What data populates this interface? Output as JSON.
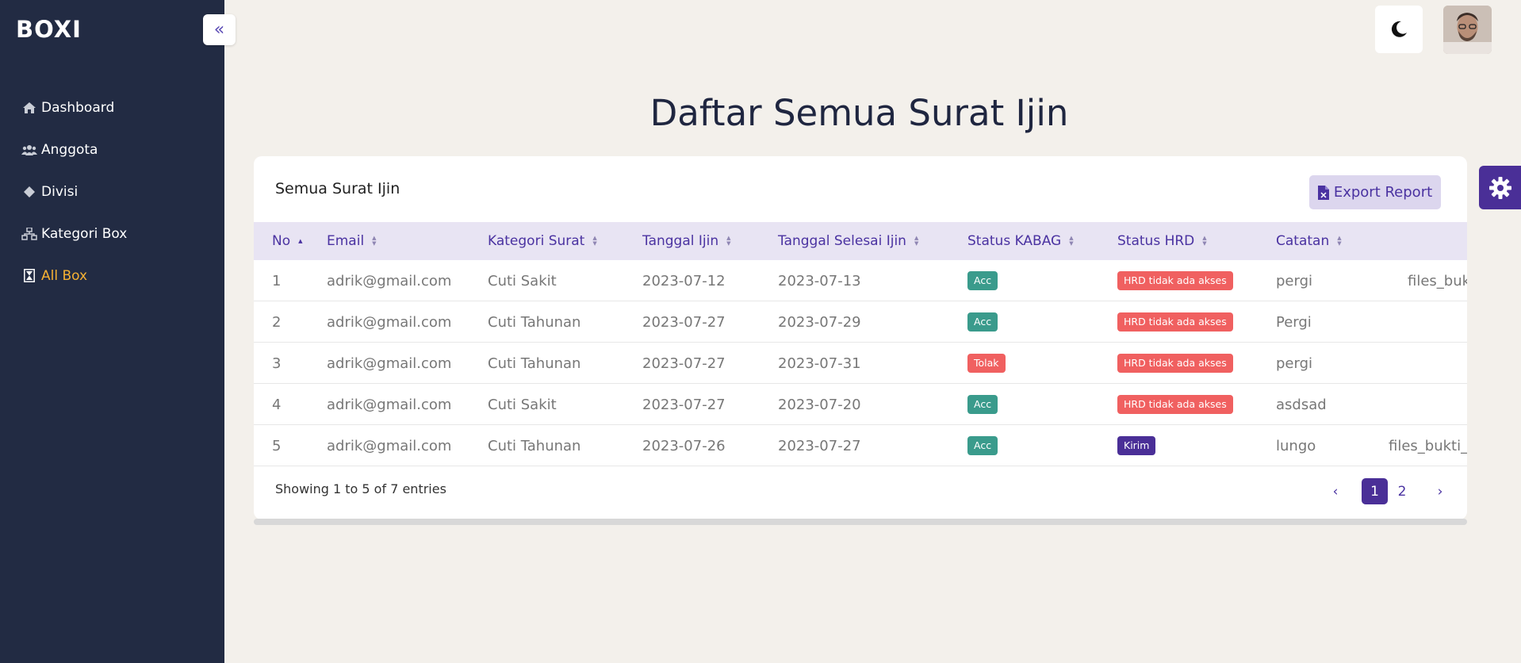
{
  "app": {
    "logo": "BOXI"
  },
  "sidebar": {
    "collapse_label": "«",
    "items": [
      {
        "label": "Dashboard",
        "icon": "home-icon"
      },
      {
        "label": "Anggota",
        "icon": "users-icon"
      },
      {
        "label": "Divisi",
        "icon": "diamond-icon"
      },
      {
        "label": "Kategori Box",
        "icon": "sitemap-icon"
      },
      {
        "label": "All Box",
        "icon": "hourglass-icon",
        "active": true
      }
    ]
  },
  "page": {
    "title": "Daftar Semua Surat Ijin"
  },
  "card": {
    "title": "Semua Surat Ijin",
    "export_label": "Export Report"
  },
  "table": {
    "columns": [
      "No",
      "Email",
      "Kategori Surat",
      "Tanggal Ijin",
      "Tanggal Selesai Ijin",
      "Status KABAG",
      "Status HRD",
      "Catatan"
    ],
    "rows": [
      {
        "no": "1",
        "email": "adrik@gmail.com",
        "kategori": "Cuti Sakit",
        "tanggal": "2023-07-12",
        "selesai": "2023-07-13",
        "kabag": "Acc",
        "hrd": "HRD tidak ada akses",
        "catatan": "pergi",
        "file": "files_buk"
      },
      {
        "no": "2",
        "email": "adrik@gmail.com",
        "kategori": "Cuti Tahunan",
        "tanggal": "2023-07-27",
        "selesai": "2023-07-29",
        "kabag": "Acc",
        "hrd": "HRD tidak ada akses",
        "catatan": "Pergi",
        "file": ""
      },
      {
        "no": "3",
        "email": "adrik@gmail.com",
        "kategori": "Cuti Tahunan",
        "tanggal": "2023-07-27",
        "selesai": "2023-07-31",
        "kabag": "Tolak",
        "hrd": "HRD tidak ada akses",
        "catatan": "pergi",
        "file": ""
      },
      {
        "no": "4",
        "email": "adrik@gmail.com",
        "kategori": "Cuti Sakit",
        "tanggal": "2023-07-27",
        "selesai": "2023-07-20",
        "kabag": "Acc",
        "hrd": "HRD tidak ada akses",
        "catatan": "asdsad",
        "file": ""
      },
      {
        "no": "5",
        "email": "adrik@gmail.com",
        "kategori": "Cuti Tahunan",
        "tanggal": "2023-07-26",
        "selesai": "2023-07-27",
        "kabag": "Acc",
        "hrd": "Kirim",
        "catatan": "lungo",
        "file": "files_bukti_"
      }
    ]
  },
  "footer": {
    "showing": "Showing 1 to 5 of 7 entries"
  },
  "pagination": {
    "prev": "‹",
    "pages": [
      "1",
      "2"
    ],
    "current": "1",
    "next": "›"
  },
  "colors": {
    "sidebar": "#222b43",
    "accent": "#4a2f97",
    "active_nav": "#f6b133",
    "acc": "#3a9b8c",
    "danger": "#f06060"
  }
}
